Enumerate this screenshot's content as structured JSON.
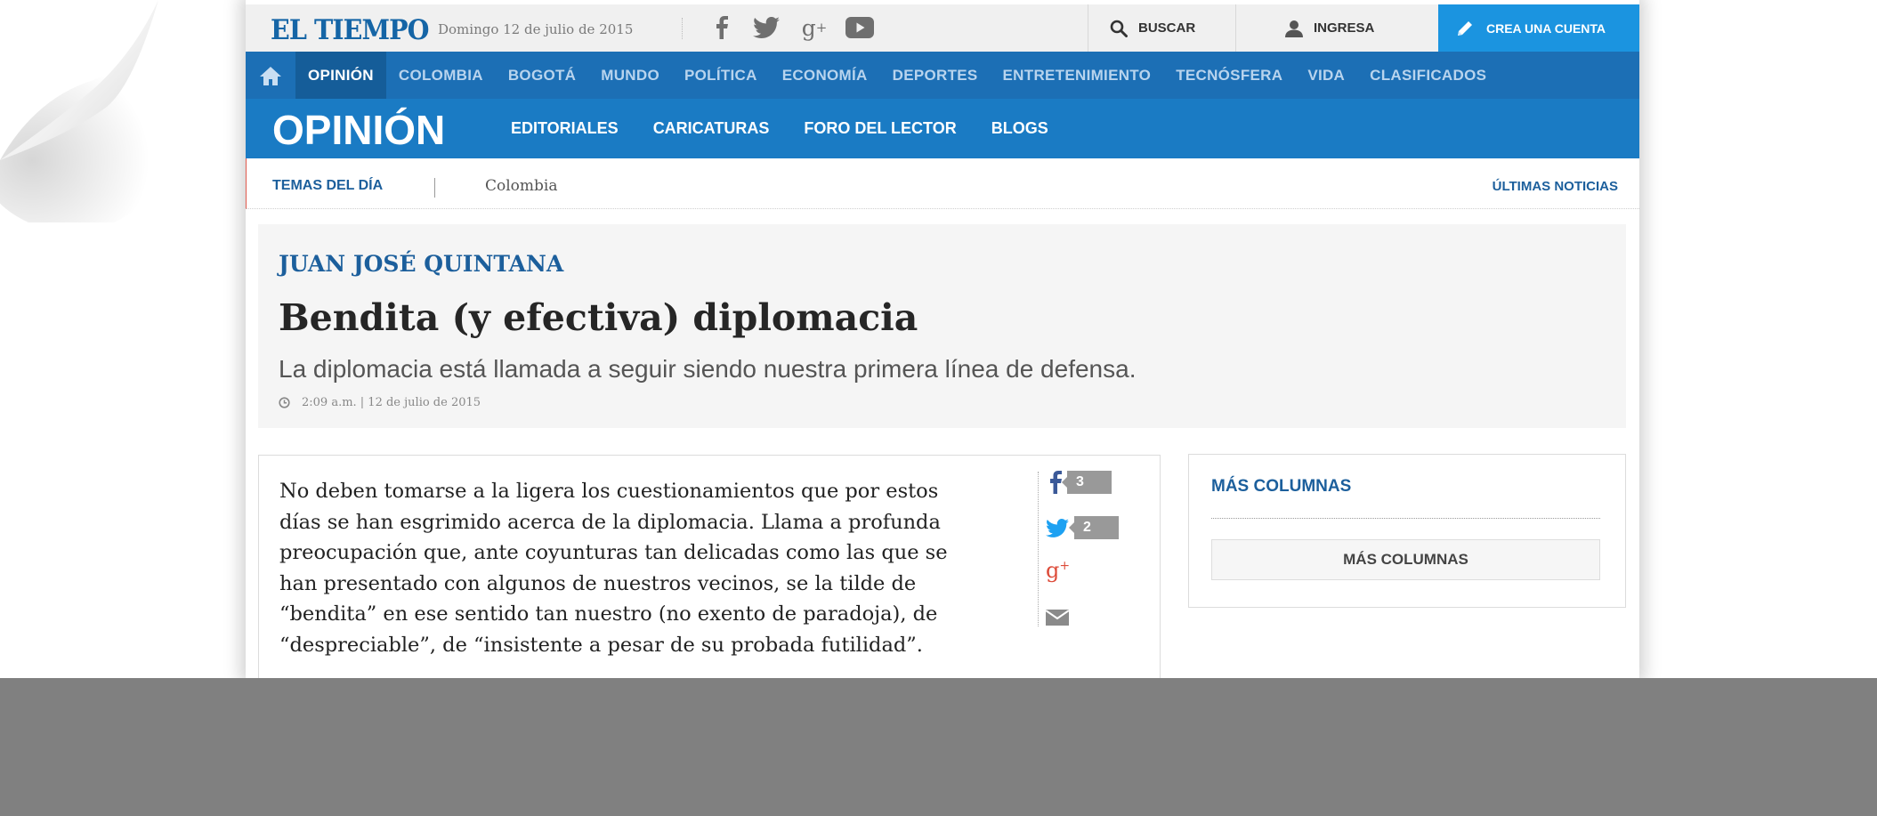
{
  "header": {
    "logo": "EL TIEMPO",
    "date": "Domingo 12 de julio de 2015",
    "social_icons": [
      "facebook-icon",
      "twitter-icon",
      "google-plus-icon",
      "youtube-icon"
    ],
    "search_label": "BUSCAR",
    "login_label": "INGRESA",
    "create_account_label": "CREA UNA CUENTA"
  },
  "nav": {
    "items": [
      {
        "label": "OPINIÓN",
        "active": true
      },
      {
        "label": "COLOMBIA"
      },
      {
        "label": "BOGOTÁ"
      },
      {
        "label": "MUNDO"
      },
      {
        "label": "POLÍTICA"
      },
      {
        "label": "ECONOMÍA"
      },
      {
        "label": "DEPORTES"
      },
      {
        "label": "ENTRETENIMIENTO"
      },
      {
        "label": "TECNÓSFERA"
      },
      {
        "label": "VIDA"
      },
      {
        "label": "CLASIFICADOS"
      }
    ]
  },
  "section": {
    "title": "OPINIÓN",
    "items": [
      "EDITORIALES",
      "CARICATURAS",
      "FORO DEL LECTOR",
      "BLOGS"
    ]
  },
  "topics": {
    "label": "TEMAS DEL DÍA",
    "topic": "Colombia",
    "latest_news": "ÚLTIMAS NOTICIAS"
  },
  "article": {
    "author": "JUAN JOSÉ QUINTANA",
    "headline": "Bendita (y efectiva) diplomacia",
    "subtitle": "La diplomacia está llamada a seguir siendo nuestra primera línea de defensa.",
    "timestamp": "2:09 a.m. | 12 de julio de 2015",
    "body_lines": [
      "No deben tomarse a la ligera los cuestionamientos que por estos",
      "días se han esgrimido acerca de la diplomacia. Llama a profunda",
      "preocupación que, ante coyunturas tan delicadas como las que se",
      "han presentado con algunos de nuestros vecinos, se la tilde de",
      "“bendita” en ese sentido tan nuestro (no exento de paradoja), de",
      "“despreciable”, de “insistente a pesar de su probada futilidad”."
    ]
  },
  "share": {
    "facebook_count": "3",
    "twitter_count": "2",
    "colors": {
      "facebook": "#3b5998",
      "twitter": "#1da1f2",
      "google_plus": "#dd4b39",
      "email": "#888888"
    }
  },
  "sidebar": {
    "title": "MÁS COLUMNAS",
    "button_label": "MÁS COLUMNAS"
  },
  "colors": {
    "brand_blue": "#1565a6",
    "nav_blue": "#1c6fb5",
    "section_blue": "#1a7bc4",
    "cta_blue": "#1b94e0",
    "overlay_grey": "#808080"
  }
}
